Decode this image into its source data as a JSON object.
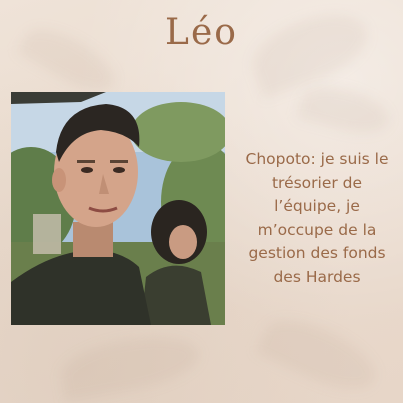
{
  "profile": {
    "name": "Léo",
    "bio": "Chopoto: je suis le\ntrésorier de\nl’équipe, je\nm’occupe de la\ngestion des fonds\ndes Hardes"
  },
  "colors": {
    "background": "#ecdfd3",
    "text": "#9a6a49"
  }
}
